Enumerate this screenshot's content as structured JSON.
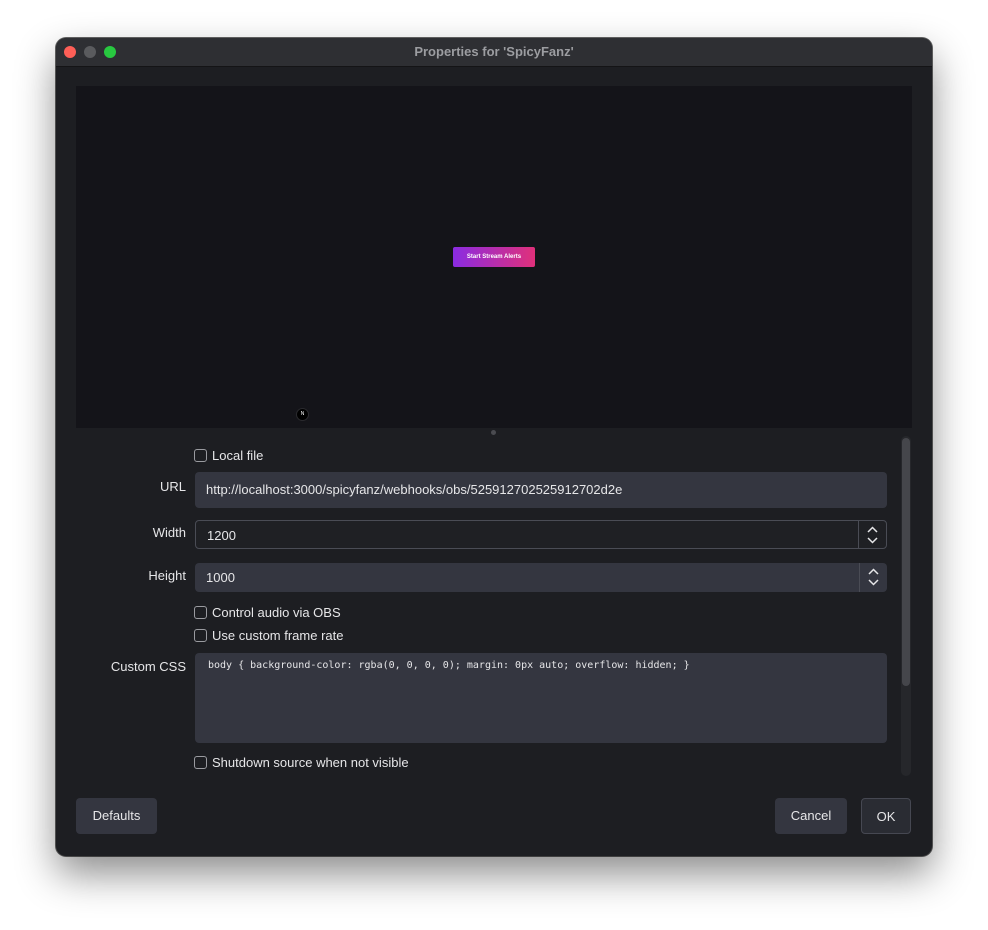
{
  "window": {
    "title": "Properties for 'SpicyFanz'"
  },
  "preview": {
    "button_label": "Start Stream Alerts",
    "badge": "N"
  },
  "form": {
    "local_file": {
      "label": "Local file",
      "checked": false
    },
    "url": {
      "label": "URL",
      "value": "http://localhost:3000/spicyfanz/webhooks/obs/525912702525912702d2e"
    },
    "width": {
      "label": "Width",
      "value": "1200"
    },
    "height": {
      "label": "Height",
      "value": "1000"
    },
    "control_audio": {
      "label": "Control audio via OBS",
      "checked": false
    },
    "custom_frame_rate": {
      "label": "Use custom frame rate",
      "checked": false
    },
    "custom_css": {
      "label": "Custom CSS",
      "value": "body { background-color: rgba(0, 0, 0, 0); margin: 0px auto; overflow: hidden; }"
    },
    "shutdown_source": {
      "label": "Shutdown source when not visible",
      "checked": false
    }
  },
  "buttons": {
    "defaults": "Defaults",
    "cancel": "Cancel",
    "ok": "OK"
  },
  "colors": {
    "window_bg": "#1d1e22",
    "titlebar_bg": "#2e2f33",
    "field_bg": "#343640",
    "preview_bg": "#141419",
    "accent_gradient_start": "#8a2be2",
    "accent_gradient_end": "#e0307a"
  }
}
